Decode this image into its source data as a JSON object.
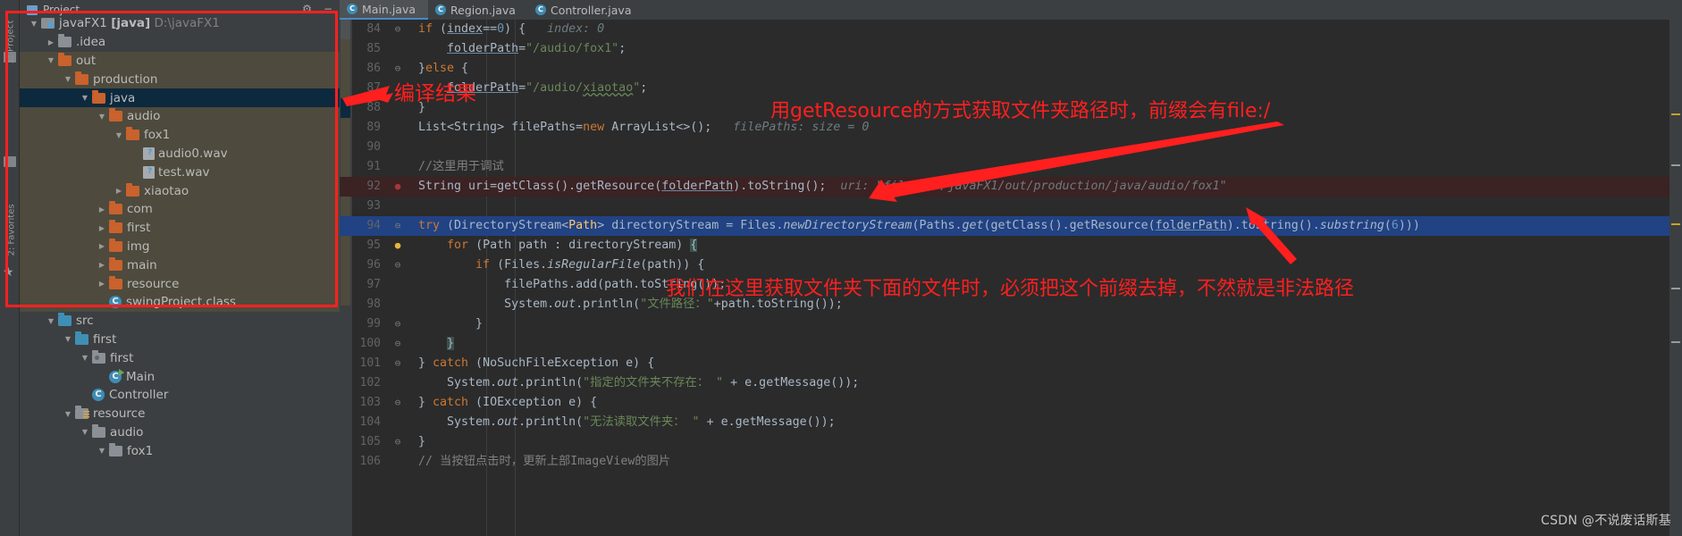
{
  "window": {
    "panel_title": "Project",
    "watermark": "CSDN @不说废话斯基"
  },
  "toolbar_strip": {
    "label_project": "1: Project",
    "label_favorites": "2: Favorites",
    "structure_icon": "structure-icon",
    "star_icon": "star-icon"
  },
  "panel_header": {
    "icons": [
      "settings-gear-icon",
      "collapse-icon",
      "hide-icon"
    ],
    "gear": "⚙",
    "minus": "−",
    "collapse": "⤒"
  },
  "project_tree": [
    {
      "indent": 0,
      "arrow": "down",
      "icon": "module",
      "label": "javaFX1 ",
      "bold": "[java]",
      "dim": "D:\\javaFX1",
      "state": "normal"
    },
    {
      "indent": 1,
      "arrow": "right",
      "icon": "gray",
      "label": ".idea",
      "state": "normal"
    },
    {
      "indent": 1,
      "arrow": "down",
      "icon": "orange",
      "label": "out",
      "state": "out"
    },
    {
      "indent": 2,
      "arrow": "down",
      "icon": "orange",
      "label": "production",
      "state": "out"
    },
    {
      "indent": 3,
      "arrow": "down",
      "icon": "orange",
      "label": "java",
      "state": "selected"
    },
    {
      "indent": 4,
      "arrow": "down",
      "icon": "orange",
      "label": "audio",
      "state": "out"
    },
    {
      "indent": 5,
      "arrow": "down",
      "icon": "orange",
      "label": "fox1",
      "state": "out"
    },
    {
      "indent": 6,
      "arrow": "none",
      "icon": "file",
      "label": "audio0.wav",
      "state": "out"
    },
    {
      "indent": 6,
      "arrow": "none",
      "icon": "file",
      "label": "test.wav",
      "state": "out"
    },
    {
      "indent": 5,
      "arrow": "right",
      "icon": "orange",
      "label": "xiaotao",
      "state": "out"
    },
    {
      "indent": 4,
      "arrow": "right",
      "icon": "orange",
      "label": "com",
      "state": "out"
    },
    {
      "indent": 4,
      "arrow": "right",
      "icon": "orange",
      "label": "first",
      "state": "out"
    },
    {
      "indent": 4,
      "arrow": "right",
      "icon": "orange",
      "label": "img",
      "state": "out"
    },
    {
      "indent": 4,
      "arrow": "right",
      "icon": "orange",
      "label": "main",
      "state": "out"
    },
    {
      "indent": 4,
      "arrow": "right",
      "icon": "orange",
      "label": "resource",
      "state": "out"
    },
    {
      "indent": 4,
      "arrow": "none",
      "icon": "class",
      "label": "swingProject.class",
      "state": "out"
    },
    {
      "indent": 1,
      "arrow": "down",
      "icon": "blue",
      "label": "src",
      "state": "normal"
    },
    {
      "indent": 2,
      "arrow": "down",
      "icon": "blue",
      "label": "first",
      "state": "normal"
    },
    {
      "indent": 3,
      "arrow": "down",
      "icon": "pkg",
      "label": "first",
      "state": "normal"
    },
    {
      "indent": 4,
      "arrow": "none",
      "icon": "class-run",
      "label": "Main",
      "state": "normal"
    },
    {
      "indent": 3,
      "arrow": "none",
      "icon": "class",
      "label": "Controller",
      "state": "normal"
    },
    {
      "indent": 2,
      "arrow": "down",
      "icon": "src-root",
      "label": "resource",
      "state": "normal"
    },
    {
      "indent": 3,
      "arrow": "down",
      "icon": "gray",
      "label": "audio",
      "state": "normal"
    },
    {
      "indent": 4,
      "arrow": "down",
      "icon": "gray",
      "label": "fox1",
      "state": "normal"
    }
  ],
  "editor_tabs": [
    {
      "label": "Main.java",
      "active": true
    },
    {
      "label": "Region.java",
      "active": false
    },
    {
      "label": "Controller.java",
      "active": false
    }
  ],
  "code_lines": [
    {
      "num": "84",
      "state": "normal",
      "gutter": "fold-down",
      "html": "<span class='k'>if</span> (<span class='t u'>index</span>==<span class='n'>0</span>) {   <span class='hint'>index: 0</span>"
    },
    {
      "num": "85",
      "state": "normal",
      "gutter": "",
      "html": "    <span class='t u'>folderPath</span>=<span class='s'>\"/audio/fox1\"</span>;"
    },
    {
      "num": "86",
      "state": "normal",
      "gutter": "fold-up",
      "html": "}<span class='k'>else</span> {"
    },
    {
      "num": "87",
      "state": "normal",
      "gutter": "",
      "html": "    <span class='t u'>folderPath</span>=<span class='s'>\"/audio/<span class='wavy'>xiaotao</span>\"</span>;"
    },
    {
      "num": "88",
      "state": "normal",
      "gutter": "",
      "html": "}"
    },
    {
      "num": "89",
      "state": "normal",
      "gutter": "",
      "html": "List&lt;<span class='t'>String</span>&gt; filePaths=<span class='k'>new</span> ArrayList&lt;&gt;();   <span class='hint'>filePaths: size = 0</span>"
    },
    {
      "num": "90",
      "state": "normal",
      "gutter": "",
      "html": ""
    },
    {
      "num": "91",
      "state": "normal",
      "gutter": "",
      "html": "<span class='c'>//这里用于调试</span>"
    },
    {
      "num": "92",
      "state": "breakpoint",
      "gutter": "bp",
      "html": "<span class='t'>String</span> uri=getClass().getResource(<span class='t u'>folderPath</span>).toString();  <span class='hint'>uri: \"file:/D:/javaFX1/out/production/java/audio/fox1\"</span>"
    },
    {
      "num": "93",
      "state": "normal",
      "gutter": "",
      "html": ""
    },
    {
      "num": "94",
      "state": "highlight",
      "gutter": "fold-down",
      "html": "<span class='k'>try</span> (<span class='t'>DirectoryStream</span>&lt;<span class='gen'>Path</span>&gt; directoryStream = Files.<span class='m'>newDirectoryStream</span>(Paths.<span class='m'>get</span>(getClass().getResource(<span class='t u'>folderPath</span>).toString().<span class='m'>substring</span>(<span class='n'>6</span>)))"
    },
    {
      "num": "95",
      "state": "normal",
      "gutter": "bulb",
      "html": "    <span class='k'>for</span> (<span class='t'>Path</span> path : directoryStream) <span class='brace-hl'>{</span>"
    },
    {
      "num": "96",
      "state": "normal",
      "gutter": "fold-down",
      "html": "        <span class='k'>if</span> (<span class='t'>Files</span>.<span class='m'>isRegularFile</span>(path)) {"
    },
    {
      "num": "97",
      "state": "normal",
      "gutter": "",
      "html": "            filePaths.add(path.toString());"
    },
    {
      "num": "98",
      "state": "normal",
      "gutter": "",
      "html": "            System.<span class='m'>out</span>.println(<span class='s'>\"文件路径：\"</span>+path.toString());"
    },
    {
      "num": "99",
      "state": "normal",
      "gutter": "fold-up",
      "html": "        }"
    },
    {
      "num": "100",
      "state": "normal",
      "gutter": "fold-up",
      "html": "    <span class='brace-hl'>}</span>"
    },
    {
      "num": "101",
      "state": "normal",
      "gutter": "fold-down",
      "html": "} <span class='k'>catch</span> (<span class='t'>NoSuchFileException</span> e) {"
    },
    {
      "num": "102",
      "state": "normal",
      "gutter": "",
      "html": "    System.<span class='m'>out</span>.println(<span class='s'>\"指定的文件夹不存在： \"</span> + e.getMessage());"
    },
    {
      "num": "103",
      "state": "normal",
      "gutter": "fold-up",
      "html": "} <span class='k'>catch</span> (<span class='t'>IOException</span> e) {"
    },
    {
      "num": "104",
      "state": "normal",
      "gutter": "",
      "html": "    System.<span class='m'>out</span>.println(<span class='s'>\"无法读取文件夹： \"</span> + e.getMessage());"
    },
    {
      "num": "105",
      "state": "normal",
      "gutter": "fold-up",
      "html": "}"
    },
    {
      "num": "106",
      "state": "normal",
      "gutter": "",
      "html": "<span class='c'>// 当按钮点击时，更新上部ImageView的图片</span>"
    }
  ],
  "annotations": {
    "compile_result_label": "编译结果",
    "prefix_note": "用getResource的方式获取文件夹路径时，前缀会有file:/",
    "substring_note": "我们在这里获取文件夹下面的文件时，必须把这个前缀去掉，不然就是非法路径",
    "color": "#ff1f1f",
    "box_name": "compile-output-highlight-box"
  }
}
